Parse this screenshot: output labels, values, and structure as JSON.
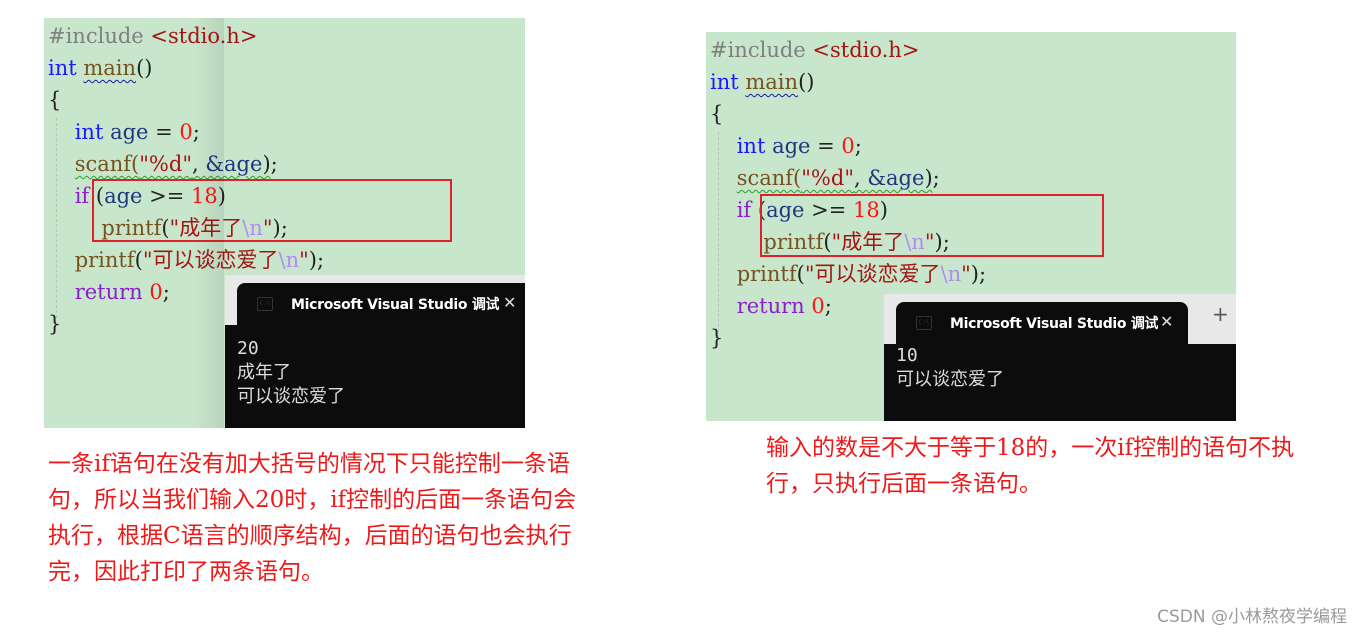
{
  "left_example": {
    "code_lines": [
      {
        "tokens": [
          {
            "t": "#include ",
            "c": "pp"
          },
          {
            "t": "<stdio.h>",
            "c": "inc"
          }
        ]
      },
      {
        "tokens": [
          {
            "t": "int",
            "c": "kw"
          },
          {
            "t": " ",
            "c": "punc"
          },
          {
            "t": "main",
            "c": "fn squig-blue"
          },
          {
            "t": "()",
            "c": "punc"
          }
        ]
      },
      {
        "tokens": [
          {
            "t": "{",
            "c": "punc"
          }
        ]
      },
      {
        "tokens": [
          {
            "t": "    ",
            "c": "punc"
          },
          {
            "t": "int",
            "c": "kw"
          },
          {
            "t": " ",
            "c": "punc"
          },
          {
            "t": "age",
            "c": "var"
          },
          {
            "t": " = ",
            "c": "punc"
          },
          {
            "t": "0",
            "c": "num"
          },
          {
            "t": ";",
            "c": "punc"
          }
        ]
      },
      {
        "tokens": [
          {
            "t": "    ",
            "c": "punc"
          },
          {
            "t": "scanf(",
            "c": "fn squig-green"
          },
          {
            "t": "\"%d\"",
            "c": "str squig-green"
          },
          {
            "t": ", ",
            "c": "punc squig-green"
          },
          {
            "t": "&age",
            "c": "var squig-green"
          },
          {
            "t": ")",
            "c": "punc squig-green"
          },
          {
            "t": ";",
            "c": "punc"
          }
        ]
      },
      {
        "tokens": [
          {
            "t": "    ",
            "c": "punc"
          },
          {
            "t": "if",
            "c": "kw2"
          },
          {
            "t": " (",
            "c": "punc"
          },
          {
            "t": "age",
            "c": "var"
          },
          {
            "t": " >= ",
            "c": "punc"
          },
          {
            "t": "18",
            "c": "num"
          },
          {
            "t": ")",
            "c": "punc"
          }
        ]
      },
      {
        "tokens": [
          {
            "t": "        ",
            "c": "punc"
          },
          {
            "t": "printf",
            "c": "fn"
          },
          {
            "t": "(",
            "c": "punc"
          },
          {
            "t": "\"成年了",
            "c": "str"
          },
          {
            "t": "\\n",
            "c": "esc"
          },
          {
            "t": "\"",
            "c": "str"
          },
          {
            "t": ");",
            "c": "punc"
          }
        ]
      },
      {
        "tokens": [
          {
            "t": "    ",
            "c": "punc"
          },
          {
            "t": "printf",
            "c": "fn"
          },
          {
            "t": "(",
            "c": "punc"
          },
          {
            "t": "\"可以谈恋爱了",
            "c": "str"
          },
          {
            "t": "\\n",
            "c": "esc"
          },
          {
            "t": "\"",
            "c": "str"
          },
          {
            "t": ");",
            "c": "punc"
          }
        ]
      },
      {
        "tokens": [
          {
            "t": "    ",
            "c": "punc"
          },
          {
            "t": "return",
            "c": "kw2"
          },
          {
            "t": " ",
            "c": "punc"
          },
          {
            "t": "0",
            "c": "num"
          },
          {
            "t": ";",
            "c": "punc"
          }
        ]
      },
      {
        "tokens": [
          {
            "t": "}",
            "c": "punc"
          }
        ]
      }
    ],
    "console": {
      "tab_title": "Microsoft Visual Studio 调试控制台",
      "close_glyph": "✕",
      "output_lines": [
        "20",
        "成年了",
        "可以谈恋爱了"
      ]
    },
    "explanation": "一条if语句在没有加大括号的情况下只能控制一条语句，所以当我们输入20时，if控制的后面一条语句会执行，根据C语言的顺序结构，后面的语句也会执行完，因此打印了两条语句。"
  },
  "right_example": {
    "code_lines": [
      {
        "tokens": [
          {
            "t": "#include ",
            "c": "pp"
          },
          {
            "t": "<stdio.h>",
            "c": "inc"
          }
        ]
      },
      {
        "tokens": [
          {
            "t": "int",
            "c": "kw"
          },
          {
            "t": " ",
            "c": "punc"
          },
          {
            "t": "main",
            "c": "fn squig-blue"
          },
          {
            "t": "()",
            "c": "punc"
          }
        ]
      },
      {
        "tokens": [
          {
            "t": "{",
            "c": "punc"
          }
        ]
      },
      {
        "tokens": [
          {
            "t": "    ",
            "c": "punc"
          },
          {
            "t": "int",
            "c": "kw"
          },
          {
            "t": " ",
            "c": "punc"
          },
          {
            "t": "age",
            "c": "var"
          },
          {
            "t": " = ",
            "c": "punc"
          },
          {
            "t": "0",
            "c": "num"
          },
          {
            "t": ";",
            "c": "punc"
          }
        ]
      },
      {
        "tokens": [
          {
            "t": "    ",
            "c": "punc"
          },
          {
            "t": "scanf(",
            "c": "fn squig-green"
          },
          {
            "t": "\"%d\"",
            "c": "str squig-green"
          },
          {
            "t": ", ",
            "c": "punc squig-green"
          },
          {
            "t": "&age",
            "c": "var squig-green"
          },
          {
            "t": ")",
            "c": "punc squig-green"
          },
          {
            "t": ";",
            "c": "punc"
          }
        ]
      },
      {
        "tokens": [
          {
            "t": "    ",
            "c": "punc"
          },
          {
            "t": "if",
            "c": "kw2"
          },
          {
            "t": " (",
            "c": "punc"
          },
          {
            "t": "age",
            "c": "var"
          },
          {
            "t": " >= ",
            "c": "punc"
          },
          {
            "t": "18",
            "c": "num"
          },
          {
            "t": ")",
            "c": "punc"
          }
        ]
      },
      {
        "tokens": [
          {
            "t": "        ",
            "c": "punc"
          },
          {
            "t": "printf",
            "c": "fn"
          },
          {
            "t": "(",
            "c": "punc"
          },
          {
            "t": "\"成年了",
            "c": "str"
          },
          {
            "t": "\\n",
            "c": "esc"
          },
          {
            "t": "\"",
            "c": "str"
          },
          {
            "t": ");",
            "c": "punc"
          }
        ]
      },
      {
        "tokens": [
          {
            "t": "    ",
            "c": "punc"
          },
          {
            "t": "printf",
            "c": "fn"
          },
          {
            "t": "(",
            "c": "punc"
          },
          {
            "t": "\"可以谈恋爱了",
            "c": "str"
          },
          {
            "t": "\\n",
            "c": "esc"
          },
          {
            "t": "\"",
            "c": "str"
          },
          {
            "t": ");",
            "c": "punc"
          }
        ]
      },
      {
        "tokens": [
          {
            "t": "    ",
            "c": "punc"
          },
          {
            "t": "return",
            "c": "kw2"
          },
          {
            "t": " ",
            "c": "punc"
          },
          {
            "t": "0",
            "c": "num"
          },
          {
            "t": ";",
            "c": "punc"
          }
        ]
      },
      {
        "tokens": [
          {
            "t": "}",
            "c": "punc"
          }
        ]
      }
    ],
    "console": {
      "tab_title": "Microsoft Visual Studio 调试控制台",
      "close_glyph": "✕",
      "add_glyph": "+",
      "output_lines": [
        "10",
        "可以谈恋爱了"
      ]
    },
    "explanation": "输入的数是不大于等于18的，一次if控制的语句不执行，只执行后面一条语句。"
  },
  "watermark": "CSDN @小林熬夜学编程",
  "colors": {
    "editor_bg": "#c8e6cc",
    "highlight_box": "#e0202a",
    "note_text": "#ee1a1a",
    "console_bg": "#0c0c0c"
  }
}
